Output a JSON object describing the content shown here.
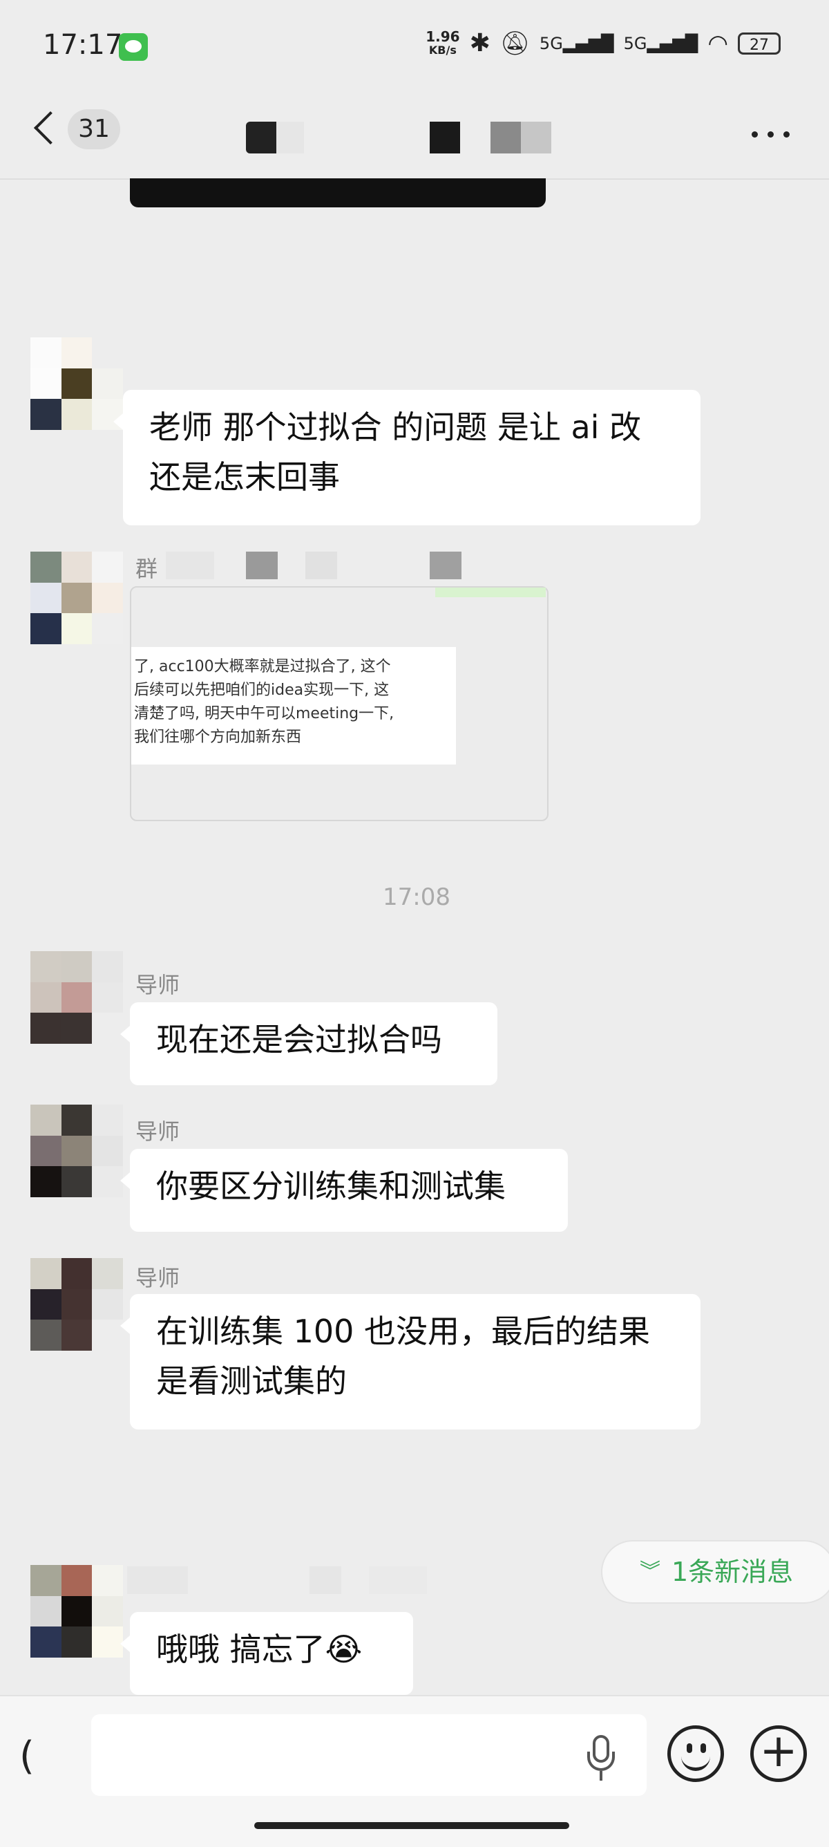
{
  "status_bar": {
    "time": "17:17",
    "net_speed_value": "1.96",
    "net_speed_unit": "KB/s",
    "signal_1": "5G",
    "signal_2": "5G",
    "battery": "27"
  },
  "nav": {
    "unread_count": "31"
  },
  "messages": [
    {
      "type": "text",
      "text_line1": "老师 那个过拟合 的问题 是让 ai 改",
      "text_line2": "还是怎末回事"
    },
    {
      "type": "image",
      "sender_prefix": "群",
      "image_text": "了, acc100大概率就是过拟合了, 这个\n后续可以先把咱们的idea实现一下, 这\n清楚了吗, 明天中午可以meeting一下,\n我们往哪个方向加新东西"
    },
    {
      "type": "timestamp",
      "text": "17:08"
    },
    {
      "type": "text",
      "sender": "导师",
      "text": "现在还是会过拟合吗"
    },
    {
      "type": "text",
      "sender": "导师",
      "text": "你要区分训练集和测试集"
    },
    {
      "type": "text",
      "sender": "导师",
      "text_line1": "在训练集 100 也没用，最后的结果",
      "text_line2": "是看测试集的"
    },
    {
      "type": "text",
      "text": "哦哦 搞忘了",
      "emoji": "😭"
    }
  ],
  "new_message_pill": {
    "icon": "double-chevron-down-icon",
    "label": "1条新消息"
  },
  "input_bar": {
    "left_glyph": "("
  },
  "colors": {
    "accent_green": "#3aa857",
    "background": "#ededed",
    "bubble": "#ffffff"
  }
}
